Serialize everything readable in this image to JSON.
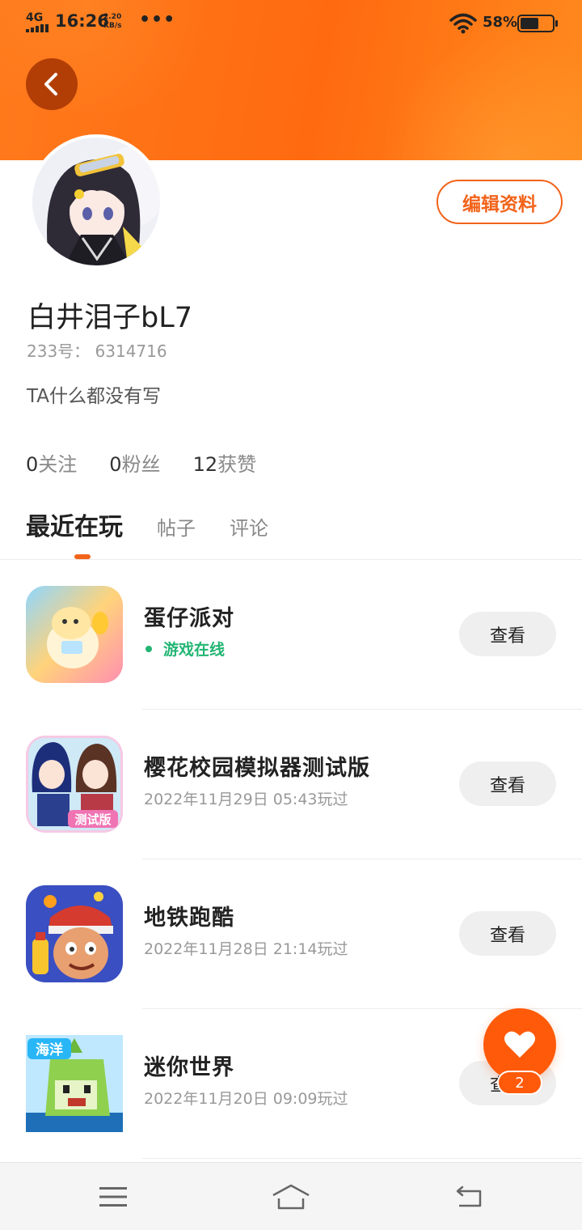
{
  "status_bar": {
    "network": "4G",
    "time": "16:26",
    "speed_value": "2.20",
    "speed_unit": "KB/s",
    "more": "•••",
    "battery_percent": "58%",
    "battery_level": 0.58
  },
  "header": {
    "back_icon": "chevron-left-icon"
  },
  "profile": {
    "username": "白井泪子bL7",
    "uid": "233号： 6314716",
    "bio": "TA什么都没有写",
    "edit_label": "编辑资料",
    "stats": [
      {
        "num": "0",
        "label": "关注"
      },
      {
        "num": "0",
        "label": "粉丝"
      },
      {
        "num": "12",
        "label": "获赞"
      }
    ]
  },
  "tabs": [
    {
      "label": "最近在玩",
      "active": true
    },
    {
      "label": "帖子",
      "active": false
    },
    {
      "label": "评论",
      "active": false
    }
  ],
  "games": [
    {
      "name": "蛋仔派对",
      "status": "游戏在线",
      "online": true,
      "button": "查看"
    },
    {
      "name": "樱花校园模拟器测试版",
      "status": "2022年11月29日 05:43玩过",
      "online": false,
      "button": "查看",
      "icon_text": "测试版"
    },
    {
      "name": "地铁跑酷",
      "status": "2022年11月28日 21:14玩过",
      "online": false,
      "button": "查看"
    },
    {
      "name": "迷你世界",
      "status": "2022年11月20日 09:09玩过",
      "online": false,
      "button": "查看",
      "icon_text": "海洋"
    }
  ],
  "fab": {
    "icon": "heart-icon",
    "badge": "2"
  },
  "navbar": {
    "items": [
      "menu-icon",
      "home-icon",
      "back-icon"
    ]
  },
  "colors": {
    "accent": "#f2631a",
    "banner": "#ff6a10",
    "online": "#22b573"
  }
}
